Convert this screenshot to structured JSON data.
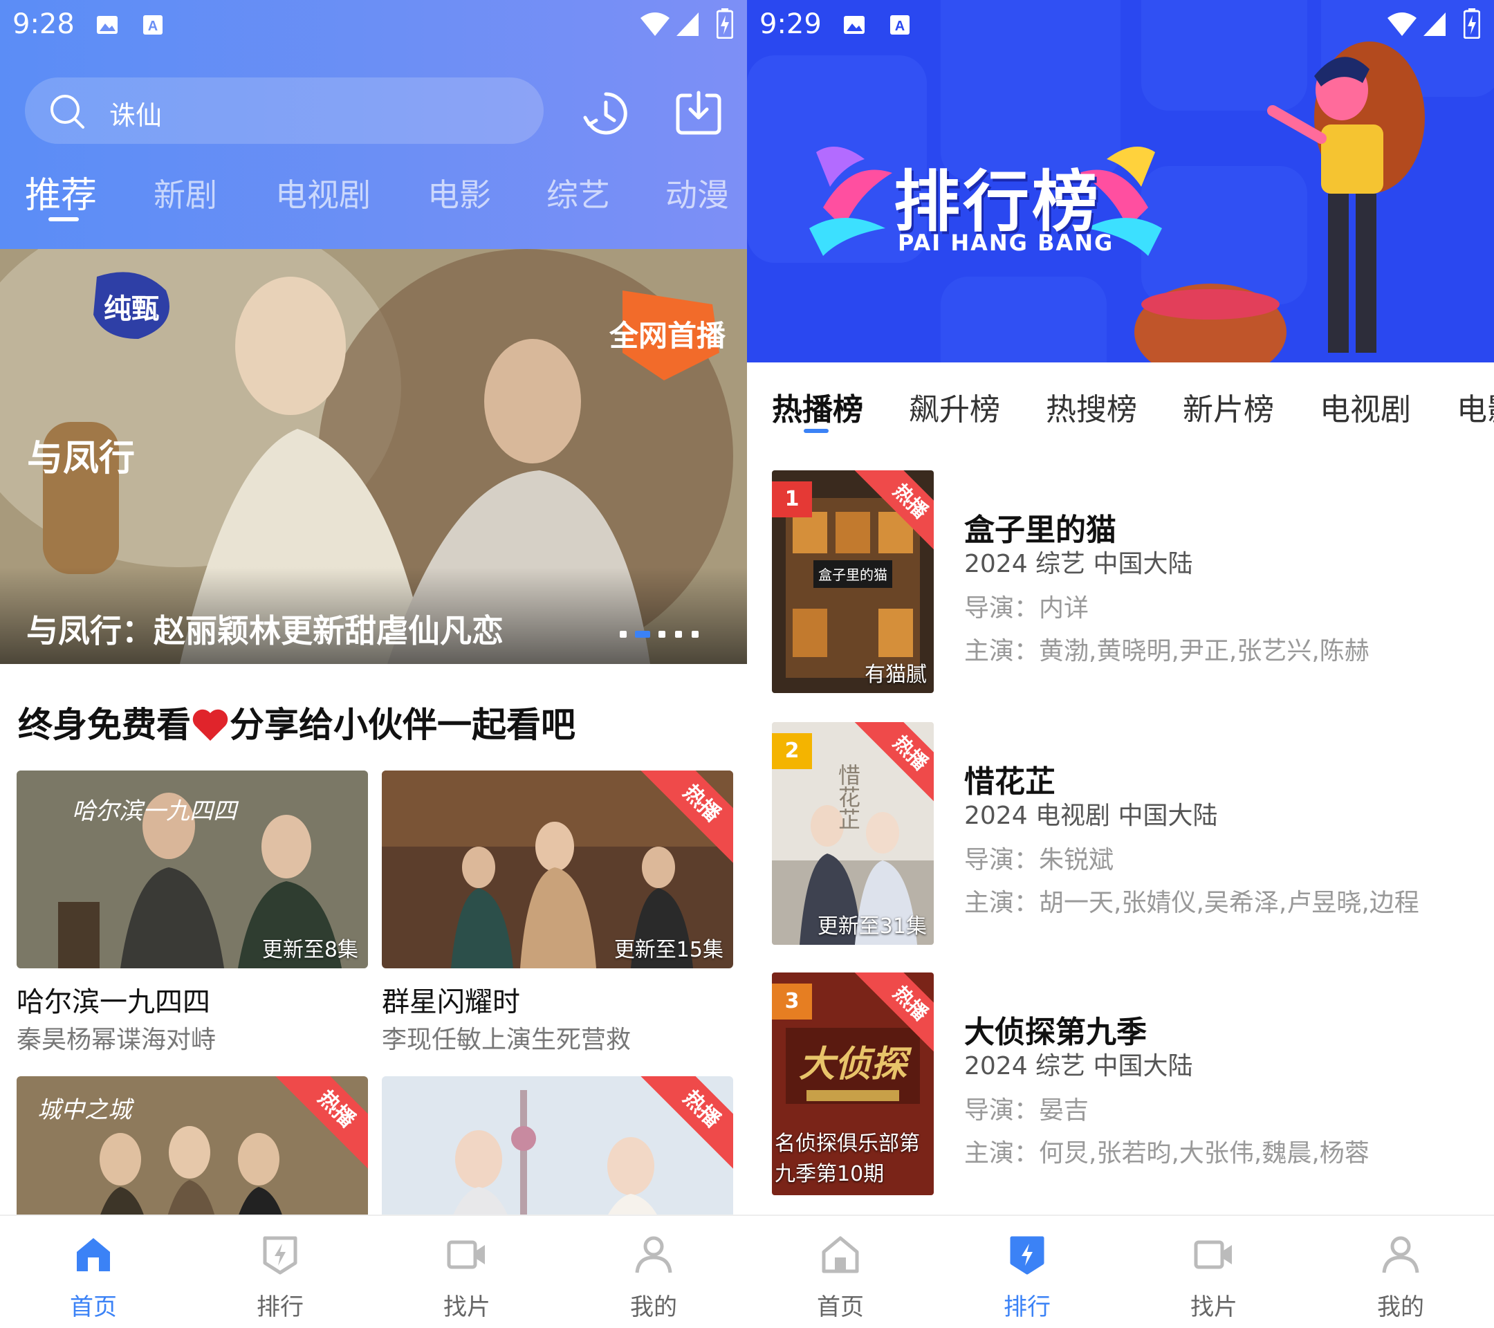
{
  "left": {
    "status": {
      "time": "9:28"
    },
    "search": {
      "text": "诛仙"
    },
    "categories": [
      {
        "label": "推荐"
      },
      {
        "label": "新剧"
      },
      {
        "label": "电视剧"
      },
      {
        "label": "电影"
      },
      {
        "label": "综艺"
      },
      {
        "label": "动漫"
      }
    ],
    "banner": {
      "caption": "与凤行：赵丽颖林更新甜虐仙凡恋",
      "poster_text": {
        "badge": "纯甄",
        "title": "与凤行",
        "corner": "全网首播"
      },
      "dots_total": 5,
      "dots_active_index": 1
    },
    "section": {
      "title_before": "终身免费看",
      "title_after": "分享给小伙伴一起看吧"
    },
    "cards": [
      {
        "title": "哈尔滨一九四四",
        "subtitle": "秦昊杨幂谍海对峙",
        "update": "更新至8集",
        "ribbon": "",
        "poster_text": "哈尔滨一九四四"
      },
      {
        "title": "群星闪耀时",
        "subtitle": "李现任敏上演生死营救",
        "update": "更新至15集",
        "ribbon": "热播",
        "poster_text": ""
      },
      {
        "title": "",
        "subtitle": "",
        "update": "",
        "ribbon": "热播",
        "poster_text": "城中之城"
      },
      {
        "title": "",
        "subtitle": "",
        "update": "",
        "ribbon": "热播",
        "poster_text": ""
      }
    ],
    "nav": [
      {
        "label": "首页",
        "icon": "home-icon"
      },
      {
        "label": "排行",
        "icon": "rank-icon"
      },
      {
        "label": "找片",
        "icon": "video-camera-icon"
      },
      {
        "label": "我的",
        "icon": "user-icon"
      }
    ],
    "nav_active": "首页"
  },
  "right": {
    "status": {
      "time": "9:29"
    },
    "banner": {
      "title": "排行榜",
      "subtitle": "PAI HANG BANG"
    },
    "tabs": [
      {
        "label": "热播榜"
      },
      {
        "label": "飙升榜"
      },
      {
        "label": "热搜榜"
      },
      {
        "label": "新片榜"
      },
      {
        "label": "电视剧"
      },
      {
        "label": "电影"
      }
    ],
    "items": [
      {
        "rank": "1",
        "name": "盒子里的猫",
        "meta": "2024  综艺  中国大陆",
        "director": "导演：内详",
        "cast": "主演：黄渤,黄晓明,尹正,张艺兴,陈赫",
        "update": "有猫腻",
        "ribbon": "热播",
        "poster_text": "盒子里的猫"
      },
      {
        "rank": "2",
        "name": "惜花芷",
        "meta": "2024  电视剧  中国大陆",
        "director": "导演：朱锐斌",
        "cast": "主演：胡一天,张婧仪,吴希泽,卢昱晓,边程",
        "update": "更新至31集",
        "ribbon": "热播",
        "poster_text": "惜花芷"
      },
      {
        "rank": "3",
        "name": "大侦探第九季",
        "meta": "2024  综艺  中国大陆",
        "director": "导演：晏吉",
        "cast": "主演：何炅,张若昀,大张伟,魏晨,杨蓉",
        "update": "名侦探俱乐部第九季第10期",
        "ribbon": "热播",
        "poster_text": "大侦探"
      }
    ],
    "nav": [
      {
        "label": "首页",
        "icon": "home-icon"
      },
      {
        "label": "排行",
        "icon": "rank-icon"
      },
      {
        "label": "找片",
        "icon": "video-camera-icon"
      },
      {
        "label": "我的",
        "icon": "user-icon"
      }
    ],
    "nav_active": "排行"
  },
  "colors": {
    "accent": "#3b82f6",
    "header_gradient_start": "#5b8df6",
    "header_gradient_end": "#7d8ff6",
    "rank_banner_bg": "#2a48f0",
    "ribbon_red": "#ef4a4a",
    "rank1_badge": "#e53935",
    "rank2_badge": "#f4b400",
    "rank3_badge": "#e67e22"
  }
}
